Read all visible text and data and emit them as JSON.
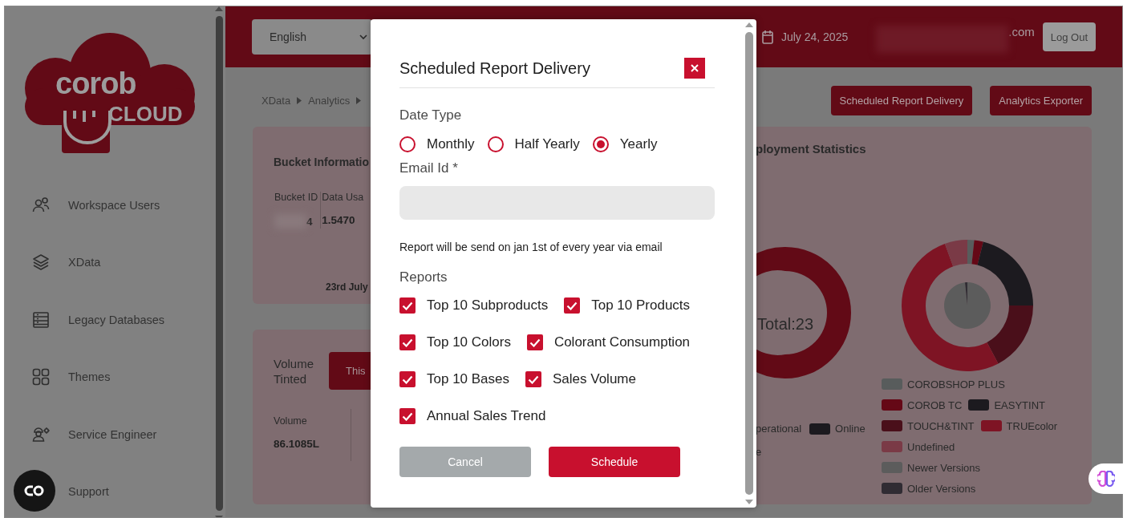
{
  "sidebar": {
    "logo": {
      "word_1": "corob",
      "word_2": "CLOUD"
    },
    "items": [
      {
        "label": "Workspace Users",
        "kind": "users"
      },
      {
        "label": "XData",
        "kind": "layers"
      },
      {
        "label": "Legacy Databases",
        "kind": "database"
      },
      {
        "label": "Themes",
        "kind": "grid"
      },
      {
        "label": "Service Engineer",
        "kind": "engineer"
      },
      {
        "label": "Support"
      }
    ]
  },
  "header": {
    "language": "English",
    "date": "July 24, 2025",
    "email_suffix": ".com",
    "logout": "Log Out"
  },
  "breadcrumb": [
    "XData",
    "Analytics"
  ],
  "actions": [
    "Scheduled Report Delivery",
    "Analytics Exporter"
  ],
  "bucket_card": {
    "title": "Bucket Informatio",
    "columns": [
      {
        "label": "Bucket ID",
        "value": "4"
      },
      {
        "label": "Data Usa",
        "value": "1.5470"
      }
    ],
    "footer": "23rd July"
  },
  "volume_card": {
    "title": "Volume Tinted",
    "tab": "This",
    "columns": [
      {
        "label": "Volume",
        "value": "86.1085L"
      }
    ]
  },
  "deployment_card": {
    "title": "ployment Statistics",
    "total": "Total:23",
    "status_legend": [
      {
        "label": "perational"
      },
      {
        "label": "Online",
        "color": "#1c1a1f"
      }
    ],
    "status_legend_more": "e",
    "version_legend_rows": [
      [
        {
          "label": "COROBSHOP PLUS",
          "color": "#585c5c"
        }
      ],
      [
        {
          "label": "COROB TC",
          "color": "#650816"
        },
        {
          "label": "EASYTINT",
          "color": "#1c1a1f"
        }
      ],
      [
        {
          "label": "TOUCH&TINT",
          "color": "#4a0f1a"
        },
        {
          "label": "TRUEcolor",
          "color": "#7e1424"
        }
      ],
      [
        {
          "label": "Undefined",
          "color": "#7a3a46"
        }
      ],
      [
        {
          "label": "Newer Versions",
          "color": "#5c5c5c"
        }
      ],
      [
        {
          "label": "Older Versions",
          "color": "#302c33"
        }
      ]
    ]
  },
  "modal": {
    "title": "Scheduled Report Delivery",
    "date_type_label": "Date Type",
    "date_types": [
      {
        "label": "Monthly",
        "selected": false
      },
      {
        "label": "Half Yearly",
        "selected": false
      },
      {
        "label": "Yearly",
        "selected": true
      }
    ],
    "email_label": "Email Id *",
    "note": "Report will be send on jan 1st of every year via email",
    "reports_label": "Reports",
    "reports": [
      {
        "label": "Top 10 Subproducts",
        "checked": true
      },
      {
        "label": "Top 10 Products",
        "checked": true
      },
      {
        "label": "Top 10 Colors",
        "checked": true
      },
      {
        "label": "Colorant Consumption",
        "checked": true
      },
      {
        "label": "Top 10 Bases",
        "checked": true
      },
      {
        "label": "Sales Volume",
        "checked": true
      },
      {
        "label": "Annual Sales Trend",
        "checked": true
      }
    ],
    "buttons": [
      {
        "label": "Cancel",
        "kind": "secondary"
      },
      {
        "label": "Schedule",
        "kind": "primary"
      }
    ]
  }
}
